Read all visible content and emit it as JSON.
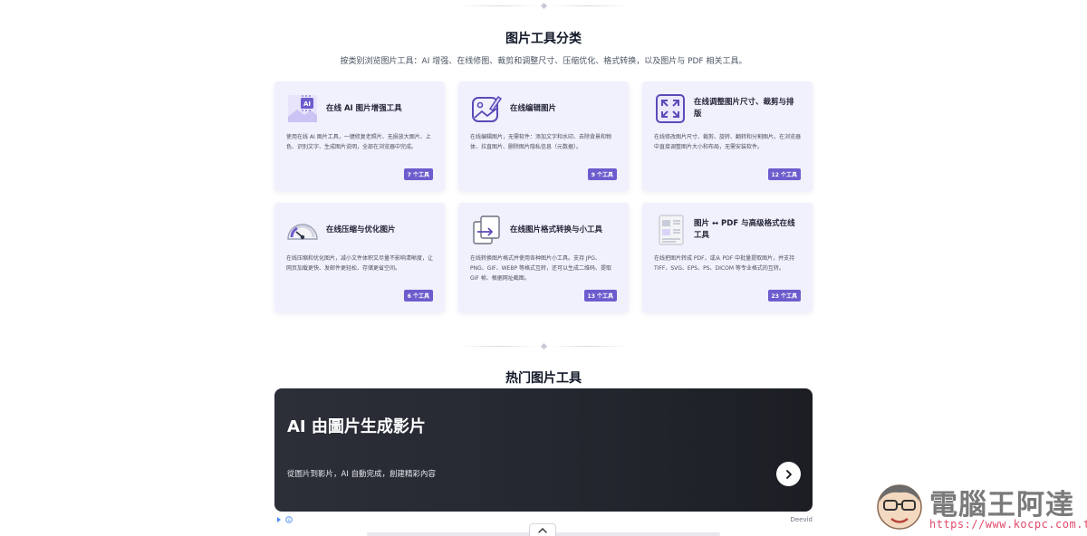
{
  "categories": {
    "title": "图片工具分类",
    "subtitle": "按类别浏览图片工具：AI 增强、在线修图、裁剪和调整尺寸、压缩优化、格式转换，以及图片与 PDF 相关工具。",
    "cards": [
      {
        "title": "在线 AI 图片增强工具",
        "description": "使用在线 AI 图片工具，一键修复老照片、无损放大图片、上色、识别文字、生成图片说明，全部在浏览器中完成。",
        "count": "7 个工具",
        "icon": "ai-image-icon"
      },
      {
        "title": "在线编辑图片",
        "description": "在线编辑图片，无需软件：添加文字和水印、去除背景和物体、拉直图片、删除图片隐私信息（元数据）。",
        "count": "9 个工具",
        "icon": "image-edit-icon"
      },
      {
        "title": "在线调整图片尺寸、裁剪与排版",
        "description": "在线修改图片尺寸、裁剪、旋转、翻转和分割图片。在浏览器中直接调整图片大小和布局，无需安装软件。",
        "count": "12 个工具",
        "icon": "resize-icon"
      },
      {
        "title": "在线压缩与优化图片",
        "description": "在线压缩和优化图片，减小文件体积又尽量不影响清晰度，让网页加载更快、发邮件更轻松、存储更省空间。",
        "count": "6 个工具",
        "icon": "compress-gauge-icon"
      },
      {
        "title": "在线图片格式转换与小工具",
        "description": "在线转换图片格式并使用各种图片小工具。支持 JPG、PNG、GIF、WEBP 等格式互转，还可以生成二维码、提取 GIF 帧、根据网址截图。",
        "count": "13 个工具",
        "icon": "convert-icon"
      },
      {
        "title": "图片 ↔ PDF 与高级格式在线工具",
        "description": "在线把图片转成 PDF，或从 PDF 中批量提取图片，并支持 TIFF、SVG、EPS、PS、DICOM 等专业格式的互转。",
        "count": "23 个工具",
        "icon": "pdf-document-icon"
      }
    ]
  },
  "popular": {
    "title": "热门图片工具"
  },
  "promo": {
    "title": "AI 由圖片生成影片",
    "subtitle": "從圖片到影片，AI 自動完成，創建精彩內容",
    "brand": "Deevid",
    "ad_icons": [
      "play-icon",
      "info-icon"
    ]
  },
  "watermark": {
    "name": "電腦王阿達",
    "url": "https://www.kocpc.com.tw/"
  },
  "colors": {
    "card_bg": "#f1f0fd",
    "accent": "#6d5ccd",
    "promo_bg": "#26282f"
  }
}
